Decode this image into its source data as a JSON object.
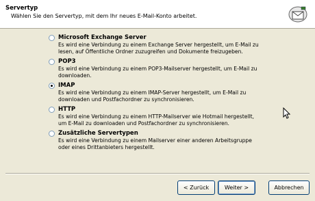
{
  "header": {
    "title": "Servertyp",
    "subtitle": "Wählen Sie den Servertyp, mit dem Ihr neues E-Mail-Konto arbeitet."
  },
  "options": [
    {
      "label": "Microsoft Exchange Server",
      "desc_lines": [
        "Es wird eine Verbindung zu einem Exchange Server hergestellt, um E-Mail zu",
        "lesen, auf Öffentliche Ordner zuzugreifen und Dokumente freizugeben."
      ],
      "checked": false
    },
    {
      "label": "POP3",
      "desc_lines": [
        "Es wird eine Verbindung zu einem POP3-Mailserver hergestellt, um E-Mail zu",
        "downloaden."
      ],
      "checked": false
    },
    {
      "label": "IMAP",
      "desc_lines": [
        "Es wird eine Verbindung zu einem IMAP-Server hergestellt, um E-Mail zu",
        "downloaden und Postfachordner zu synchronisieren."
      ],
      "checked": true
    },
    {
      "label": "HTTP",
      "desc_lines": [
        "Es wird eine Verbindung zu einem HTTP-Mailserver wie Hotmail hergestellt,",
        "um E-Mail zu downloaden und Postfachordner zu synchronisieren."
      ],
      "checked": false
    },
    {
      "label": "Zusätzliche Servertypen",
      "desc_lines": [
        "Es wird eine Verbindung zu einem Mailserver einer anderen Arbeitsgruppe",
        "oder eines Drittanbieters hergestellt."
      ],
      "checked": false
    }
  ],
  "buttons": {
    "back": "< Zurück",
    "next": "Weiter >",
    "cancel": "Abbrechen"
  }
}
